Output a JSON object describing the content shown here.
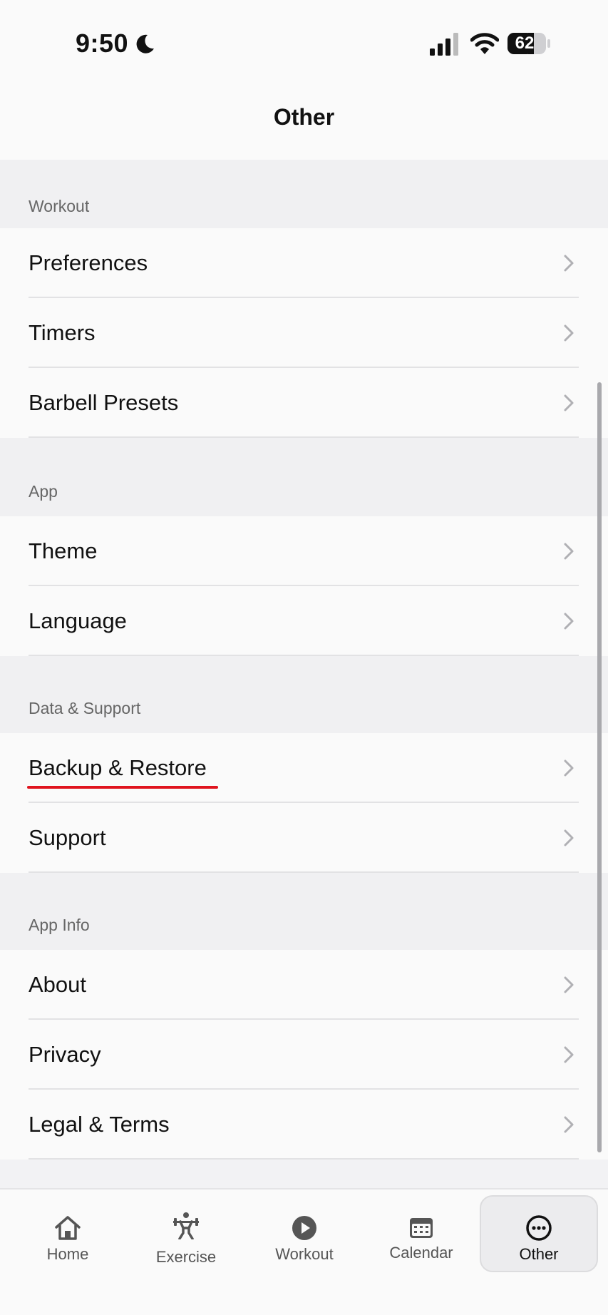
{
  "status_bar": {
    "time": "9:50",
    "battery": "62",
    "icons": [
      "moon-icon",
      "signal-icon",
      "wifi-icon",
      "battery-icon"
    ]
  },
  "header": {
    "title": "Other"
  },
  "sections": [
    {
      "label": "Workout",
      "items": [
        {
          "label": "Preferences"
        },
        {
          "label": "Timers"
        },
        {
          "label": "Barbell Presets"
        }
      ]
    },
    {
      "label": "App",
      "items": [
        {
          "label": "Theme"
        },
        {
          "label": "Language"
        }
      ]
    },
    {
      "label": "Data & Support",
      "items": [
        {
          "label": "Backup & Restore"
        },
        {
          "label": "Support"
        }
      ]
    },
    {
      "label": "App Info",
      "items": [
        {
          "label": "About"
        },
        {
          "label": "Privacy"
        },
        {
          "label": "Legal & Terms"
        }
      ]
    }
  ],
  "tab_bar": {
    "tabs": [
      {
        "label": "Home",
        "icon": "home-icon"
      },
      {
        "label": "Exercise",
        "icon": "exercise-icon"
      },
      {
        "label": "Workout",
        "icon": "play-icon"
      },
      {
        "label": "Calendar",
        "icon": "calendar-icon"
      },
      {
        "label": "Other",
        "icon": "more-icon"
      }
    ],
    "active": "Other"
  },
  "colors": {
    "highlight_underline": "#e0141e",
    "row_background": "#fafafa",
    "section_background": "#f0f0f2"
  }
}
